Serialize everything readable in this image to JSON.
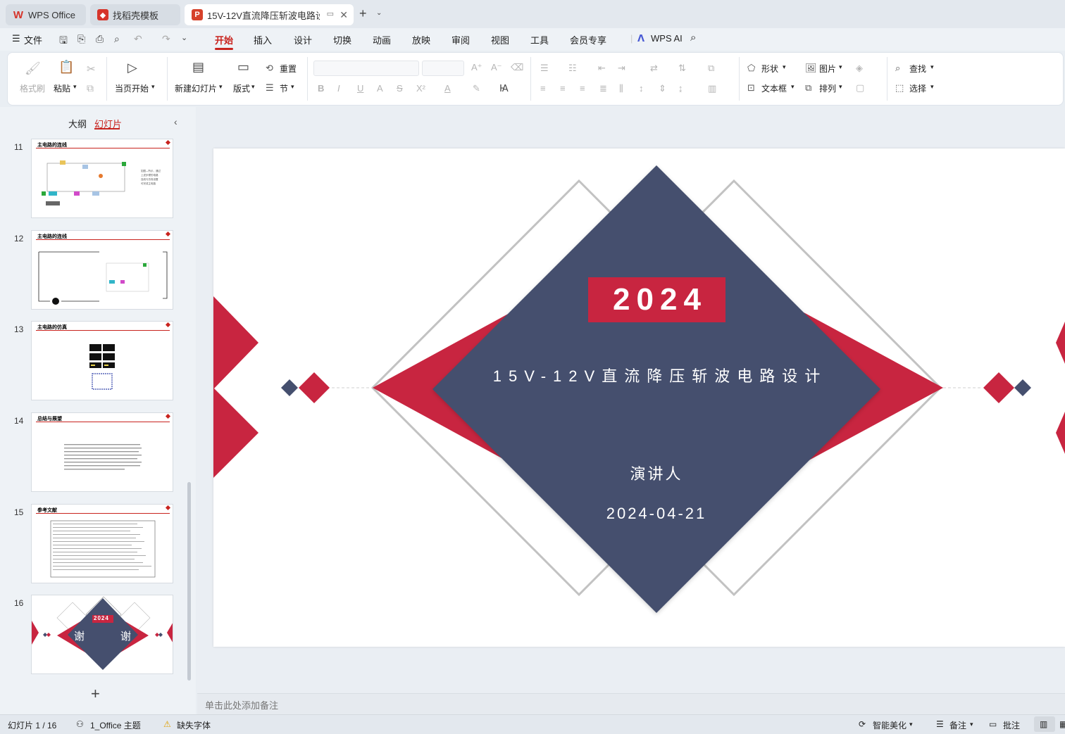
{
  "tabs": [
    {
      "label": "WPS Office"
    },
    {
      "label": "找稻壳模板"
    },
    {
      "label": "15V-12V直流降压斩波电路设"
    }
  ],
  "menu": {
    "file": "文件",
    "items": [
      "开始",
      "插入",
      "设计",
      "切换",
      "动画",
      "放映",
      "审阅",
      "视图",
      "工具",
      "会员专享"
    ],
    "active": "开始",
    "wps_ai": "WPS AI"
  },
  "ribbon": {
    "format_painter": "格式刷",
    "paste": "粘贴",
    "from_current": "当页开始",
    "new_slide": "新建幻灯片",
    "layout": "版式",
    "reset": "重置",
    "section": "节",
    "shape": "形状",
    "picture": "图片",
    "textbox": "文本框",
    "arrange": "排列",
    "find": "查找",
    "select": "选择"
  },
  "panel": {
    "outline_tab": "大纲",
    "slides_tab": "幻灯片",
    "slides": [
      {
        "num": "11",
        "title": "主电路的连线"
      },
      {
        "num": "12",
        "title": "主电路的连线"
      },
      {
        "num": "13",
        "title": "主电路的仿真"
      },
      {
        "num": "14",
        "title": "总结与展望"
      },
      {
        "num": "15",
        "title": "参考文献"
      },
      {
        "num": "16",
        "year": "2024",
        "left_char": "谢",
        "right_char": "谢"
      }
    ]
  },
  "slide": {
    "year": "2024",
    "title": "15V-12V直流降压斩波电路设计",
    "presenter": "演讲人",
    "date": "2024-04-21"
  },
  "notes_placeholder": "单击此处添加备注",
  "status": {
    "slide_counter": "幻灯片 1 / 16",
    "theme": "1_Office 主题",
    "missing_font": "缺失字体",
    "smart_beautify": "智能美化",
    "notes": "备注",
    "comments": "批注"
  },
  "colors": {
    "accent_red": "#c8231e",
    "slide_navy": "#454f6e",
    "slide_red": "#c82540"
  }
}
